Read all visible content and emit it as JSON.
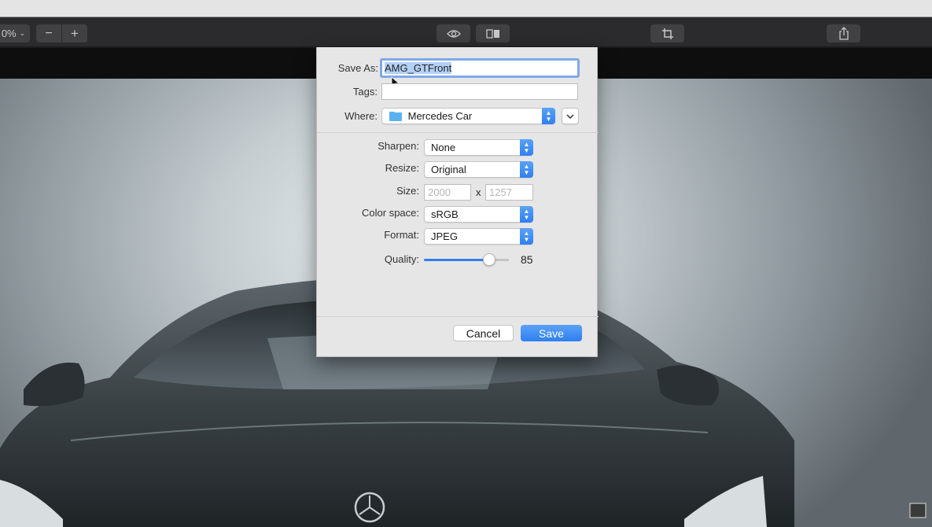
{
  "toolbar": {
    "zoom_value": "0%",
    "zoom_out_icon": "minus-icon",
    "zoom_in_icon": "plus-icon",
    "preview_icon": "eye-icon",
    "split_icon": "split-view-icon",
    "crop_icon": "crop-icon",
    "share_icon": "share-icon"
  },
  "dialog": {
    "save_as_label": "Save As:",
    "save_as_value": "AMG_GTFront",
    "tags_label": "Tags:",
    "tags_value": "",
    "where_label": "Where:",
    "where_value": "Mercedes Car",
    "where_folder_icon": "folder-icon",
    "sharpen_label": "Sharpen:",
    "sharpen_value": "None",
    "resize_label": "Resize:",
    "resize_value": "Original",
    "size_label": "Size:",
    "size_width": "2000",
    "size_separator": "x",
    "size_height": "1257",
    "color_space_label": "Color space:",
    "color_space_value": "sRGB",
    "format_label": "Format:",
    "format_value": "JPEG",
    "quality_label": "Quality:",
    "quality_value": "85",
    "quality_fraction": 0.77,
    "cancel_label": "Cancel",
    "save_label": "Save",
    "accent_color": "#2f7ff0"
  }
}
